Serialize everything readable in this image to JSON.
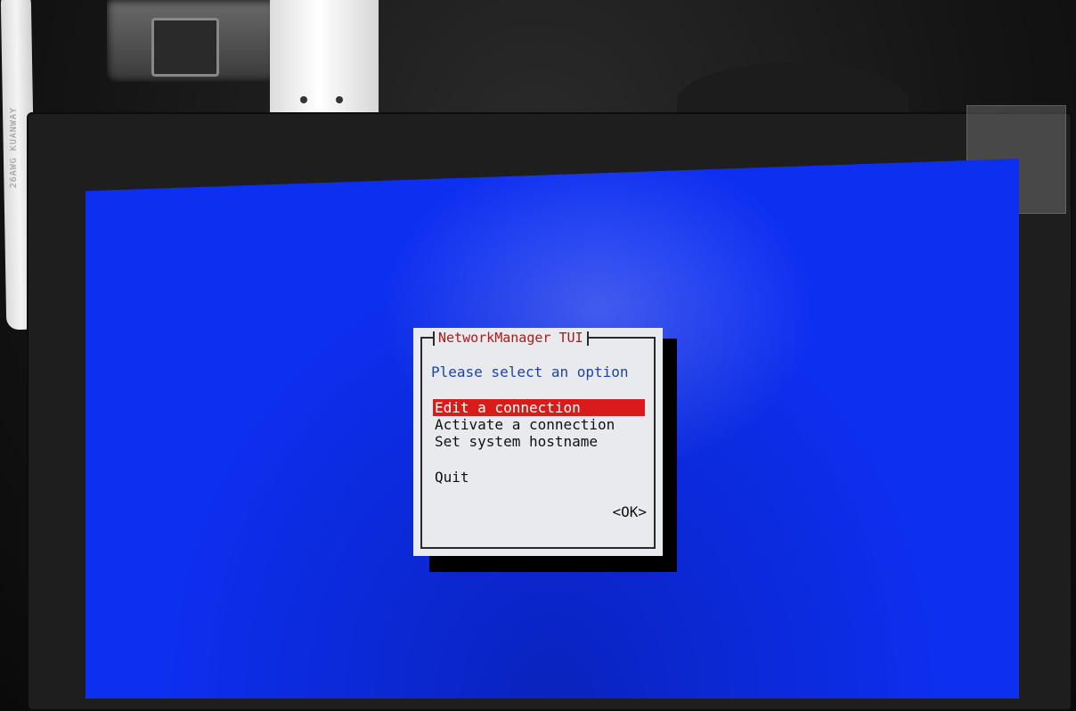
{
  "background": {
    "cable_print": "26AWG KUANWAY"
  },
  "screen": {
    "bg_color": "#0d2ff0"
  },
  "dialog": {
    "title": "NetworkManager TUI",
    "prompt": "Please select an option",
    "menu": {
      "items": [
        {
          "label": "Edit a connection",
          "selected": true
        },
        {
          "label": "Activate a connection",
          "selected": false
        },
        {
          "label": "Set system hostname",
          "selected": false
        },
        {
          "label": "Quit",
          "selected": false
        }
      ]
    },
    "ok_label": "<OK>",
    "colors": {
      "title": "#b01818",
      "prompt": "#1a44a8",
      "highlight": "#d81c1c",
      "dialog_bg": "#e8eaee"
    }
  }
}
